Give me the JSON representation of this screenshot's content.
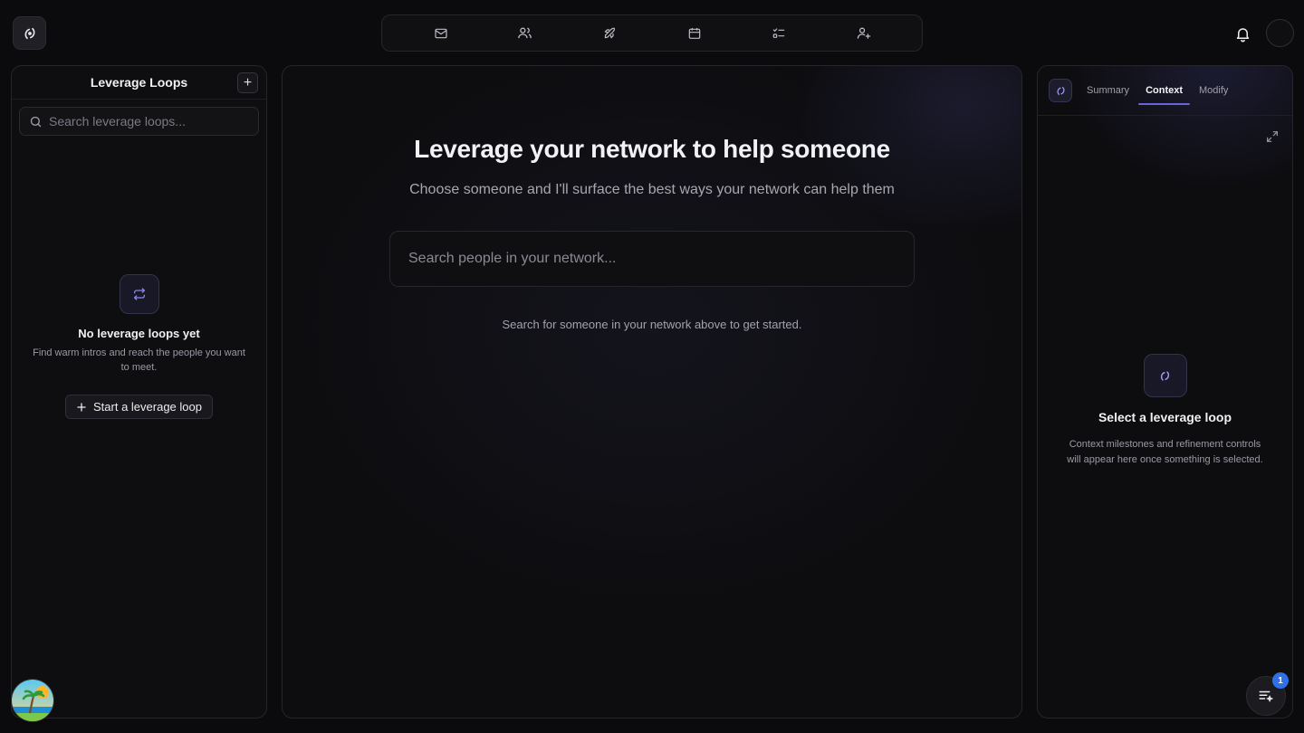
{
  "nav": {
    "items": [
      {
        "icon": "mail-icon"
      },
      {
        "icon": "users-icon"
      },
      {
        "icon": "rocket-icon"
      },
      {
        "icon": "calendar-icon"
      },
      {
        "icon": "checklist-icon"
      },
      {
        "icon": "user-plus-icon"
      }
    ]
  },
  "left_panel": {
    "title": "Leverage Loops",
    "add_label": "+",
    "search_placeholder": "Search leverage loops...",
    "empty_title": "No leverage loops yet",
    "empty_desc": "Find warm intros and reach the people you want to meet.",
    "start_button_label": "Start a leverage loop"
  },
  "center_panel": {
    "title": "Leverage your network to help someone",
    "subtitle": "Choose someone and I'll surface the best ways your network can help them",
    "search_placeholder": "Search people in your network...",
    "hint": "Search for someone in your network above to get started."
  },
  "right_panel": {
    "tabs": [
      {
        "label": "Summary",
        "active": false
      },
      {
        "label": "Context",
        "active": true
      },
      {
        "label": "Modify",
        "active": false
      }
    ],
    "empty_title": "Select a leverage loop",
    "empty_desc": "Context milestones and refinement controls will appear here once something is selected."
  },
  "notifications": {
    "badge_count": "1"
  },
  "colors": {
    "accent": "#6b63d8",
    "badge": "#2f6fe8",
    "background": "#0b0b0d"
  }
}
